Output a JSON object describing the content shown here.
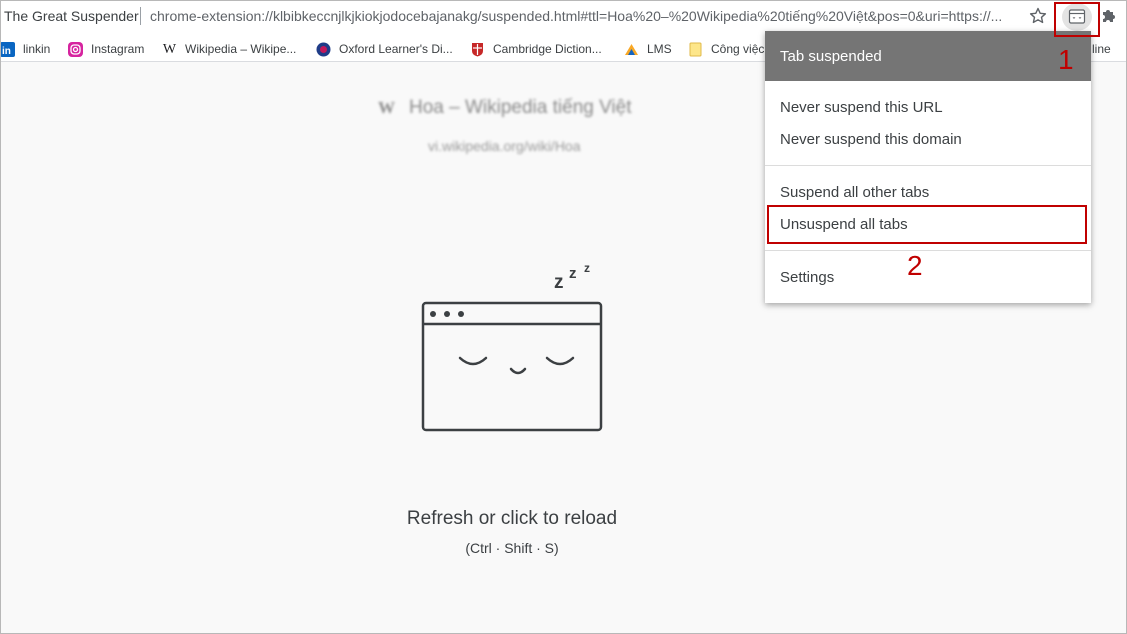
{
  "omnibox": {
    "title": "The Great Suspender",
    "url": "chrome-extension://klbibkeccnjlkjkiokjodocebajanakg/suspended.html#ttl=Hoa%20–%20Wikipedia%20tiếng%20Việt&pos=0&uri=https://..."
  },
  "icons": {
    "star": "star-icon",
    "extension": "great-suspender-icon",
    "puzzle": "extensions-puzzle-icon"
  },
  "bookmarks": [
    {
      "label": "linkin",
      "icon": "linkedin-icon"
    },
    {
      "label": "Instagram",
      "icon": "instagram-icon"
    },
    {
      "label": "Wikipedia – Wikipe...",
      "icon": "wikipedia-icon"
    },
    {
      "label": "Oxford Learner's Di...",
      "icon": "oxford-icon"
    },
    {
      "label": "Cambridge Diction...",
      "icon": "cambridge-icon"
    },
    {
      "label": "LMS",
      "icon": "lms-icon"
    },
    {
      "label": "Công việc",
      "icon": "folder-icon"
    },
    {
      "label": "line",
      "icon": ""
    }
  ],
  "page": {
    "title": "Hoa – Wikipedia tiếng Việt",
    "title_icon": "W",
    "url": "vi.wikipedia.org/wiki/Hoa",
    "sleep_text": "z z z",
    "reload": "Refresh or click to reload",
    "shortcut": "(Ctrl · Shift · S)"
  },
  "popup": {
    "header": "Tab suspended",
    "items": [
      "Never suspend this URL",
      "Never suspend this domain",
      "Suspend all other tabs",
      "Unsuspend all tabs",
      "Settings"
    ]
  },
  "annotations": {
    "step1": "1",
    "step2": "2"
  },
  "colors": {
    "accent_red": "#c00000",
    "popup_header": "#757575"
  }
}
